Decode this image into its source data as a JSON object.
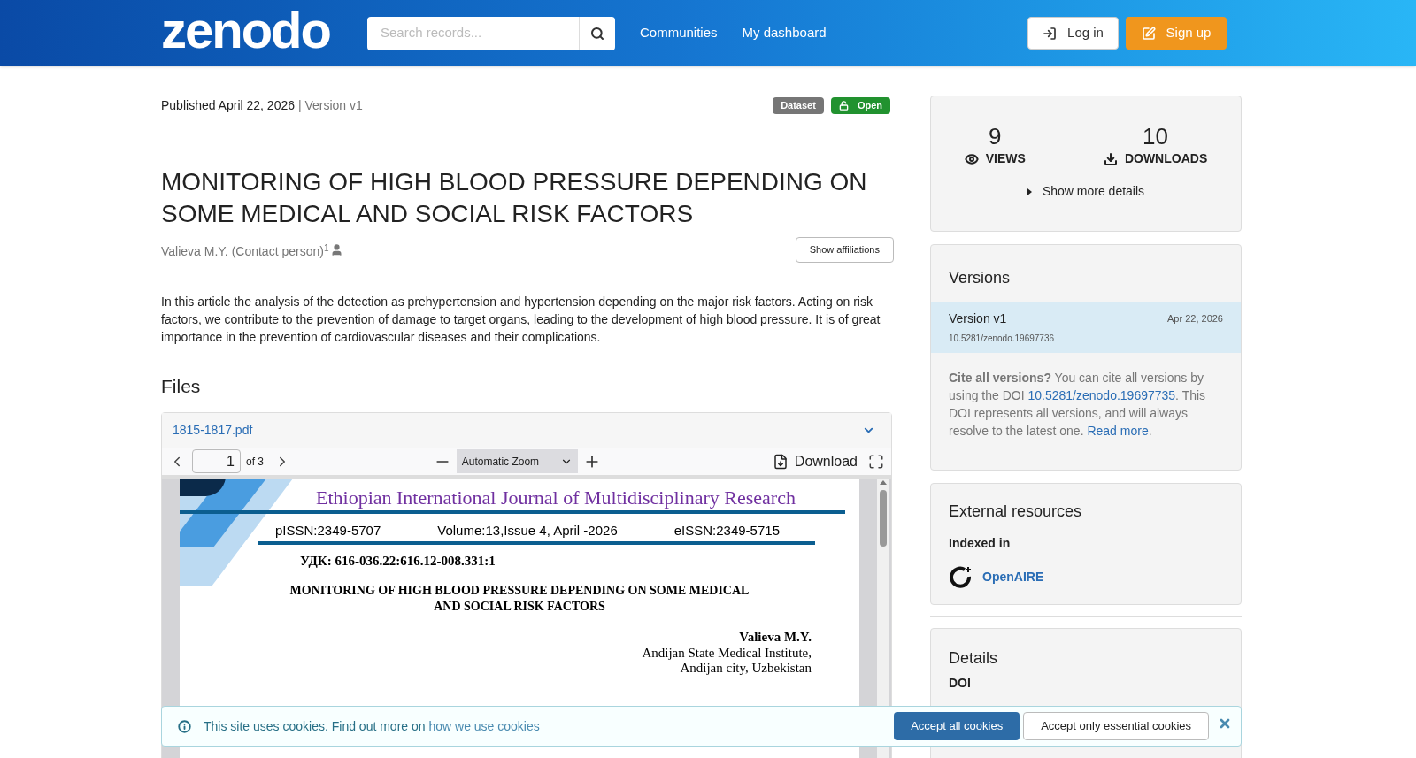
{
  "header": {
    "logo": "zenodo",
    "search": {
      "placeholder": "Search records..."
    },
    "nav": [
      "Communities",
      "My dashboard"
    ],
    "login": "Log in",
    "signup": "Sign up"
  },
  "record": {
    "published": "Published April 22, 2026",
    "version": "| Version v1",
    "badges": [
      {
        "label": "Dataset",
        "kind": "type"
      },
      {
        "label": "Open",
        "kind": "access"
      }
    ],
    "title": "MONITORING OF HIGH BLOOD PRESSURE DEPENDING ON SOME MEDICAL AND SOCIAL RISK FACTORS",
    "creator": {
      "name": "Valieva M.Y. (Contact person)",
      "mark": "1"
    },
    "show_affiliations": "Show affiliations",
    "description": "In this article the analysis of the detection as prehypertension and hypertension depending on the major risk factors. Acting on risk factors, we contribute to the prevention of damage to target organs, leading to the development of high blood pressure. It is of great importance in the prevention of cardiovascular diseases and their complications.",
    "files_heading": "Files",
    "file": {
      "name": "1815-1817.pdf",
      "expanded": true
    },
    "viewer": {
      "page": "1",
      "of": "of 3",
      "zoom": "Automatic Zoom",
      "download": "Download",
      "pdf": [
        {
          "kind": "journal",
          "text": "Ethiopian International Journal of Multidisciplinary Research"
        },
        {
          "kind": "issn",
          "parts": [
            "pISSN:2349-5707",
            "Volume:13,Issue 4, April -2026",
            "eISSN:2349-5715"
          ]
        },
        {
          "kind": "udk",
          "text": "УДК: 616-036.22:616.12-008.331:1"
        },
        {
          "kind": "title",
          "text": "MONITORING OF HIGH BLOOD PRESSURE DEPENDING ON SOME MEDICAL AND SOCIAL RISK FACTORS"
        },
        {
          "kind": "author",
          "text": "Valieva M.Y."
        },
        {
          "kind": "affiliation",
          "text": "Andijan State Medical Institute,"
        },
        {
          "kind": "affiliation",
          "text": "Andijan city, Uzbekistan"
        }
      ]
    }
  },
  "sidebar": {
    "stats": [
      {
        "value": "9",
        "label": "VIEWS",
        "kind": "views"
      },
      {
        "value": "10",
        "label": "DOWNLOADS",
        "kind": "downloads"
      }
    ],
    "show_more": "Show more details",
    "versions": {
      "heading": "Versions",
      "items": [
        {
          "title": "Version v1",
          "date": "Apr 22, 2026",
          "doi": "10.5281/zenodo.19697736",
          "selected": true
        }
      ],
      "cite": {
        "lead": "Cite all versions?",
        "before": " You can cite all versions by using the DOI ",
        "doi": "10.5281/zenodo.19697735",
        "middle": ". This DOI represents all versions, and will always resolve to the latest one. ",
        "read_more": "Read more",
        "end": "."
      }
    },
    "external": {
      "heading": "External resources",
      "indexed_label": "Indexed in",
      "items": [
        {
          "name": "OpenAIRE"
        }
      ]
    },
    "details": {
      "heading": "Details",
      "fields": [
        "DOI"
      ]
    }
  },
  "cookie": {
    "text": "This site uses cookies. Find out more on",
    "link": "how we use cookies",
    "accept_all": "Accept all cookies",
    "essential": "Accept only essential cookies"
  }
}
